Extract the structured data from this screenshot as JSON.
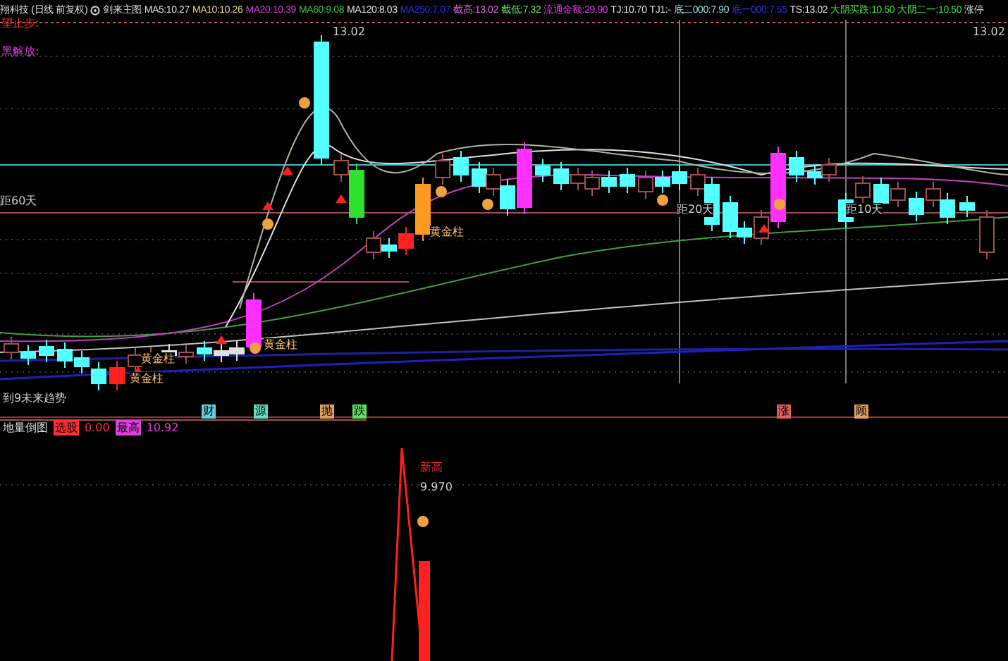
{
  "header": {
    "title": "翔科技 (日线 前复权)",
    "formula": "剑来主图",
    "indicators": [
      {
        "label": "MA5:",
        "value": "10.27",
        "color": "#e0e0e0"
      },
      {
        "label": "MA10:",
        "value": "10.26",
        "color": "#e8d890"
      },
      {
        "label": "MA20:",
        "value": "10.39",
        "color": "#d040d0"
      },
      {
        "label": "MA60:",
        "value": "9.08",
        "color": "#40c040"
      },
      {
        "label": "MA120:",
        "value": "8.03",
        "color": "#e0e0e0"
      },
      {
        "label": "MA250:",
        "value": "7.07",
        "color": "#3030e0"
      },
      {
        "label": "截高:",
        "value": "13.02",
        "color": "#e070e0"
      },
      {
        "label": "截低:",
        "value": "7.32",
        "color": "#70e070"
      },
      {
        "label": "流通金额:",
        "value": "29.90",
        "color": "#e040e0"
      },
      {
        "label": "TJ:",
        "value": "10.70",
        "color": "#e0e0e0"
      },
      {
        "label": "TJ1:",
        "value": "-",
        "color": "#e0e0e0"
      },
      {
        "label": "底二000:",
        "value": "7.90",
        "color": "#a0e0e0"
      },
      {
        "label": "底一000:",
        "value": "7.55",
        "color": "#3030e0"
      },
      {
        "label": "TS:",
        "value": "13.02",
        "color": "#e0e0e0"
      },
      {
        "label": "大阴买跌:",
        "value": "10.50",
        "color": "#40e040"
      },
      {
        "label": "大阴二一:",
        "value": "10.50",
        "color": "#40e040"
      },
      {
        "label": "涨停"
      }
    ]
  },
  "main": {
    "left_labels": [
      {
        "text": "望止步:",
        "color": "#ff3030"
      },
      {
        "text": "黑解放:",
        "color": "#e040e0"
      }
    ],
    "price_labels": [
      "13.02",
      "13.02"
    ],
    "distance_labels": [
      "距60天",
      "距20天",
      "距10天"
    ],
    "signal_labels": [
      "黄金柱",
      "黄金柱",
      "黄金柱",
      "黄金柱"
    ],
    "trend_label": "到9未来趋势",
    "markers": [
      {
        "text": "财",
        "color": "#60d0e0"
      },
      {
        "text": "源",
        "color": "#60e0c0"
      },
      {
        "text": "抛",
        "color": "#e0a060"
      },
      {
        "text": "跌",
        "color": "#60e060"
      },
      {
        "text": "涨",
        "color": "#e06060"
      },
      {
        "text": "顾",
        "color": "#e0a060"
      }
    ]
  },
  "sub": {
    "title": "地量倒图",
    "fields": [
      {
        "label": "选股",
        "value": "0.00",
        "color": "#ff3030"
      },
      {
        "label": "最高",
        "value": "10.92",
        "color": "#e040e0"
      }
    ],
    "peak_label": "新高",
    "peak_value": "9.970"
  }
}
